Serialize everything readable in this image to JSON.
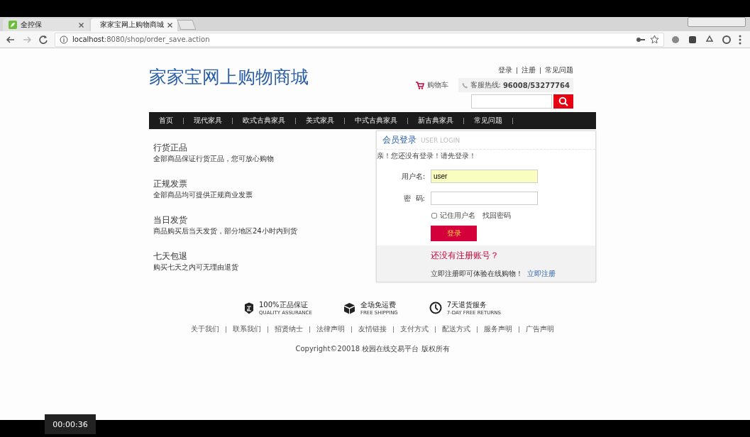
{
  "browser": {
    "tabs": [
      {
        "title": "全控保",
        "selected": false
      },
      {
        "title": "家家宝网上购物商城",
        "selected": true
      }
    ],
    "url_host": "localhost",
    "url_rest": ":8080/shop/order_save.action"
  },
  "header": {
    "logo": "家家宝网上购物商城",
    "top_links": [
      "登录",
      "注册",
      "常见问题"
    ],
    "cart": "购物车",
    "hotline_label": "客服热线:",
    "hotline": "96008/53277764"
  },
  "nav": {
    "items": [
      "首页",
      "现代家具",
      "欧式古典家具",
      "美式家具",
      "中式古典家具",
      "新古典家具",
      "常见问题"
    ]
  },
  "features": [
    {
      "title": "行货正品",
      "desc": "全部商品保证行货正品，您可放心购物"
    },
    {
      "title": "正规发票",
      "desc": "全部商品均可提供正规商业发票"
    },
    {
      "title": "当日发货",
      "desc": "商品购买后当天发货，部分地区24小时内到货"
    },
    {
      "title": "七天包退",
      "desc": "购买七天之内可无理由退货"
    }
  ],
  "login": {
    "title": "会员登录",
    "subtitle": "USER LOGIN",
    "notice": "亲！您还没有登录！请先登录！",
    "username_label": "用户名:",
    "username_value": "user",
    "password_label": "密  码:",
    "remember_label": "记住用户名",
    "remember_checked": false,
    "forgot": "找回密码",
    "submit": "登录",
    "register_prompt": "还没有注册账号？",
    "register_text": "立即注册即可体验在线购物！",
    "register_link": "立即注册"
  },
  "footer": {
    "badges": [
      {
        "kind": "shield",
        "title": "100%正品保证",
        "subtitle": "QUALITY ASSURANCE"
      },
      {
        "kind": "box",
        "title": "全场免运费",
        "subtitle": "FREE SHIPPING"
      },
      {
        "kind": "clock",
        "title": "7天退货服务",
        "subtitle": "7-DAY FREE RETURNS"
      }
    ],
    "links": [
      "关于我们",
      "联系我们",
      "招贤纳士",
      "法律声明",
      "友情链接",
      "支付方式",
      "配送方式",
      "服务声明",
      "广告声明"
    ],
    "copyright": "Copyright©20018 校园在线交易平台 版权所有"
  },
  "recording": {
    "timer": "00:00:36"
  }
}
